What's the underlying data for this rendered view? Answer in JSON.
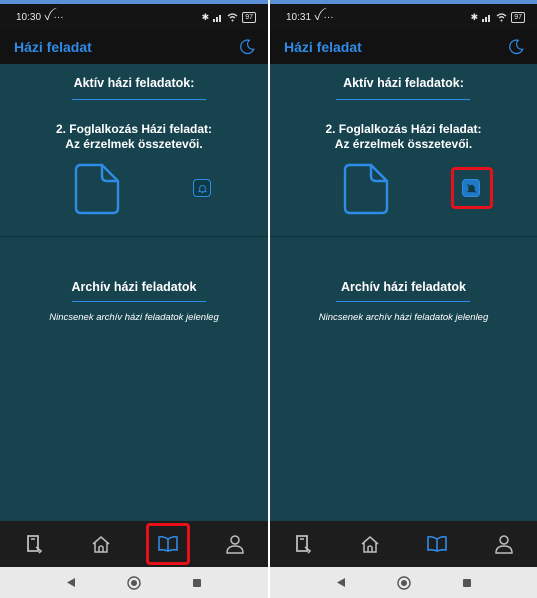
{
  "screens": [
    {
      "status": {
        "time": "10:30",
        "battery": "97"
      },
      "appbar": {
        "title": "Házi feladat"
      },
      "active_section": {
        "title": "Aktív házi feladatok:"
      },
      "homework": {
        "line1": "2. Foglalkozás Házi feladat:",
        "line2": "Az érzelmek összetevői."
      },
      "bell": {
        "state": "on",
        "highlighted": false
      },
      "archive_section": {
        "title": "Archív házi feladatok",
        "empty_text": "Nincsenek archív házi feladatok jelenleg"
      },
      "nav": {
        "active_item": "homework",
        "highlighted_item": "homework"
      }
    },
    {
      "status": {
        "time": "10:31",
        "battery": "97"
      },
      "appbar": {
        "title": "Házi feladat"
      },
      "active_section": {
        "title": "Aktív házi feladatok:"
      },
      "homework": {
        "line1": "2. Foglalkozás Házi feladat:",
        "line2": "Az érzelmek összetevői."
      },
      "bell": {
        "state": "off",
        "highlighted": true
      },
      "archive_section": {
        "title": "Archív házi feladatok",
        "empty_text": "Nincsenek archív házi feladatok jelenleg"
      },
      "nav": {
        "active_item": "homework",
        "highlighted_item": null
      }
    }
  ],
  "icons": {
    "statusbar": [
      "bluetooth-icon",
      "signal-icon",
      "wifi-icon",
      "battery-icon"
    ],
    "appbar": [
      "moon-icon"
    ],
    "nav": [
      "journal-icon",
      "home-icon",
      "book-open-icon",
      "user-icon"
    ],
    "system_nav": [
      "back-triangle-icon",
      "home-circle-icon",
      "recents-square-icon"
    ]
  },
  "colors": {
    "background": "#17434f",
    "accent": "#2f8be6",
    "highlight": "#e8101a",
    "bar": "#121212"
  }
}
